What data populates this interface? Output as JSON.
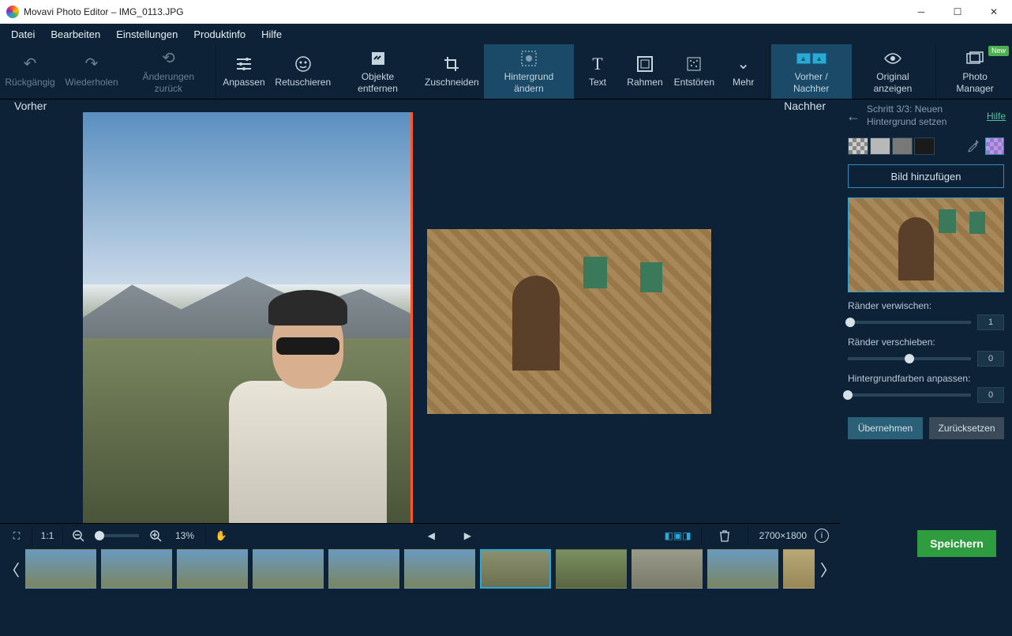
{
  "title": "Movavi Photo Editor – IMG_0113.JPG",
  "menu": [
    "Datei",
    "Bearbeiten",
    "Einstellungen",
    "Produktinfo",
    "Hilfe"
  ],
  "toolbar": {
    "undo": "Rückgängig",
    "redo": "Wiederholen",
    "revert": "Änderungen zurück",
    "adjust": "Anpassen",
    "retouch": "Retuschieren",
    "remove": "Objekte entfernen",
    "crop": "Zuschneiden",
    "bg": "Hintergrund ändern",
    "text": "Text",
    "frame": "Rahmen",
    "denoise": "Entstören",
    "more": "Mehr",
    "beforeafter": "Vorher / Nachher",
    "original": "Original anzeigen",
    "manager": "Photo Manager",
    "new_badge": "New"
  },
  "canvas": {
    "before": "Vorher",
    "after": "Nachher"
  },
  "panel": {
    "step": "Schritt 3/3: Neuen Hintergrund setzen",
    "help": "Hilfe",
    "add_image": "Bild hinzufügen",
    "blur_edges": "Ränder verwischen:",
    "shift_edges": "Ränder verschieben:",
    "adapt_colors": "Hintergrundfarben anpassen:",
    "blur_val": "1",
    "shift_val": "0",
    "adapt_val": "0",
    "apply": "Übernehmen",
    "reset": "Zurücksetzen"
  },
  "bottom": {
    "fit_label": "1:1",
    "zoom": "13%",
    "dimensions": "2700×1800"
  },
  "save": "Speichern"
}
